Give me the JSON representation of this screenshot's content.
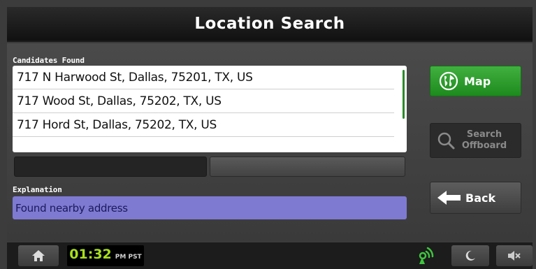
{
  "header": {
    "title": "Location Search"
  },
  "candidates": {
    "label": "Candidates Found",
    "items": [
      "717 N Harwood St, Dallas, 75201, TX, US",
      "717 Wood St, Dallas, 75202, TX, US",
      "717 Hord St, Dallas, 75202, TX, US"
    ]
  },
  "explanation": {
    "label": "Explanation",
    "text": "Found nearby address"
  },
  "buttons": {
    "map": {
      "label": "Map",
      "icon": "globe-icon"
    },
    "search_offboard": {
      "label_line1": "Search",
      "label_line2": "Offboard",
      "icon": "magnifier-icon"
    },
    "back": {
      "label": "Back",
      "icon": "left-arrow-icon"
    }
  },
  "statusbar": {
    "time": "01:32",
    "ampm_zone": "PM PST",
    "icons": [
      "home-icon",
      "signal-icon",
      "night-mode-icon",
      "mute-icon"
    ]
  },
  "colors": {
    "map_button": "#2a9a2a",
    "explanation_bg": "#7e7ad2",
    "clock_text": "#a8e01a"
  }
}
